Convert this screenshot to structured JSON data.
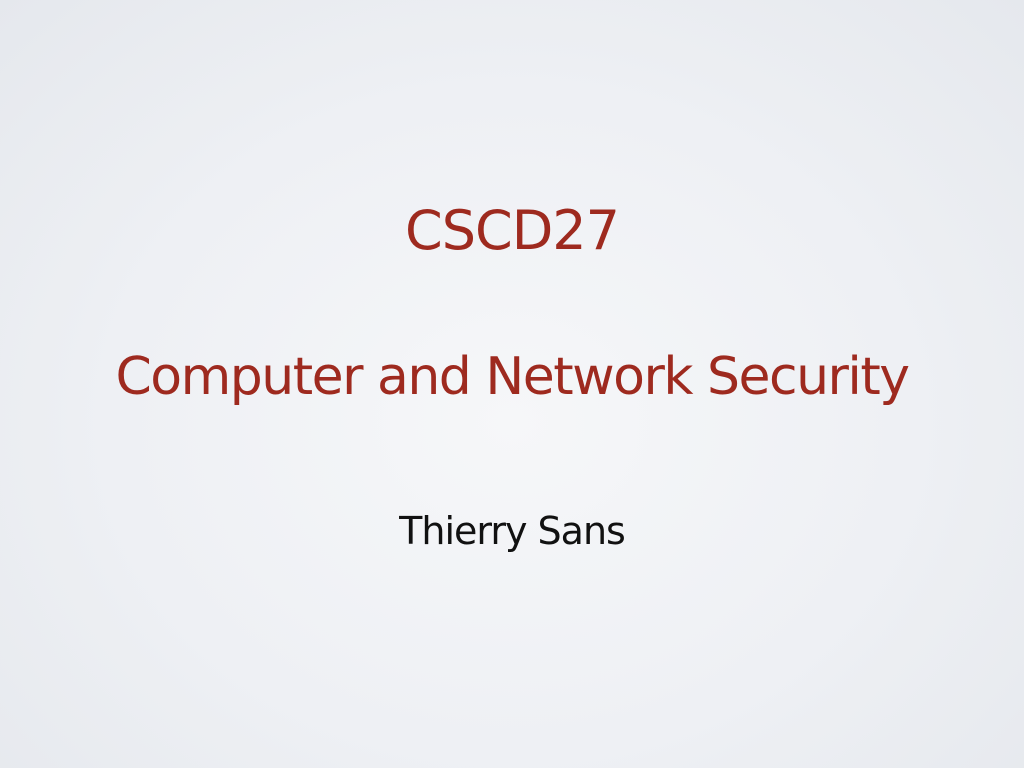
{
  "slide": {
    "course_code": "CSCD27",
    "course_title": "Computer and Network Security",
    "author": "Thierry Sans"
  },
  "colors": {
    "title_color": "#9e2a1f",
    "author_color": "#111111",
    "background": "#eef0f4"
  }
}
